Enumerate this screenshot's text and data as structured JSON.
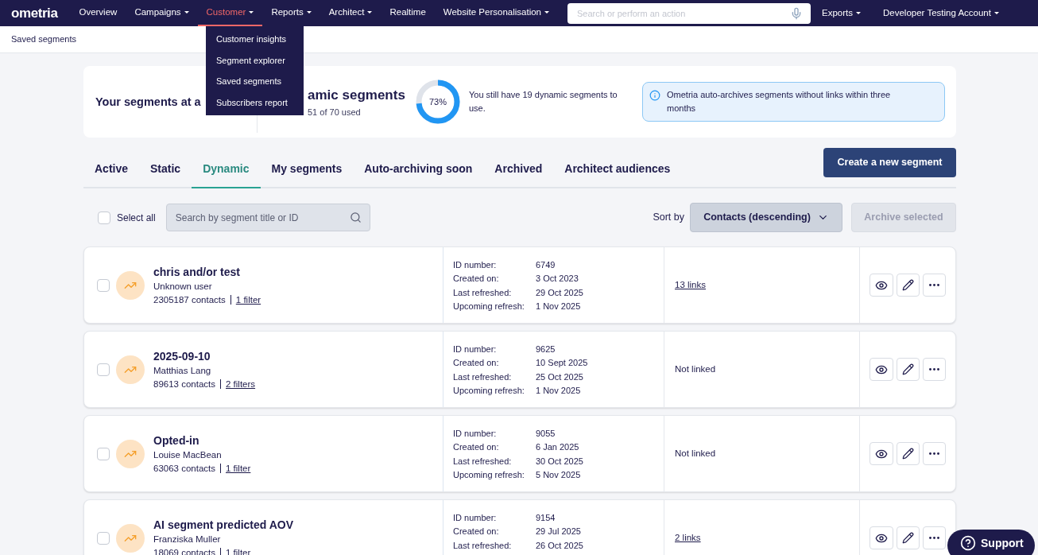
{
  "nav": {
    "logo": "ometria",
    "items": [
      {
        "label": "Overview",
        "menu": false,
        "selected": false
      },
      {
        "label": "Campaigns",
        "menu": true,
        "selected": false
      },
      {
        "label": "Customer",
        "menu": true,
        "selected": true
      },
      {
        "label": "Reports",
        "menu": true,
        "selected": false
      },
      {
        "label": "Architect",
        "menu": true,
        "selected": false
      },
      {
        "label": "Realtime",
        "menu": false,
        "selected": false
      },
      {
        "label": "Website Personalisation",
        "menu": true,
        "selected": false
      }
    ],
    "search": {
      "placeholder": "Search or perform an action"
    },
    "right_items": [
      {
        "label": "Exports",
        "menu": true
      },
      {
        "label": "Developer Testing Account",
        "menu": true
      }
    ]
  },
  "dropdown": {
    "items": [
      "Customer insights",
      "Segment explorer",
      "Saved segments",
      "Subscribers report"
    ]
  },
  "breadcrumb": "Saved segments",
  "summary": {
    "heading": "Your segments at a",
    "title": "amic segments",
    "used": "51 of 70 used",
    "donut": {
      "level": 0.73,
      "label": "73%"
    },
    "remaining": "You still have 19 dynamic segments to use.",
    "info": "Ometria auto-archives segments without links within three months"
  },
  "tabs": [
    {
      "label": "Active",
      "selected": false
    },
    {
      "label": "Static",
      "selected": false
    },
    {
      "label": "Dynamic",
      "selected": true
    },
    {
      "label": "My segments",
      "selected": false
    },
    {
      "label": "Auto-archiving soon",
      "selected": false
    },
    {
      "label": "Archived",
      "selected": false
    },
    {
      "label": "Architect audiences",
      "selected": false
    }
  ],
  "create_button": "Create a new segment",
  "toolbar": {
    "select_all": {
      "label": "Select all",
      "checked": false
    },
    "search": {
      "placeholder": "Search by segment title or ID"
    },
    "sort_label": "Sort by",
    "sort_value": "Contacts (descending)",
    "archive": {
      "label": "Archive selected",
      "disabled": true
    }
  },
  "segments": [
    {
      "checked": false,
      "title": "chris and/or test",
      "owner": "Unknown user",
      "contacts": "2305187 contacts",
      "filters": "1 filter",
      "details": [
        {
          "label": "ID number:",
          "value": "6749"
        },
        {
          "label": "Created on:",
          "value": "3 Oct 2023"
        },
        {
          "label": "Last refreshed:",
          "value": "29 Oct 2025"
        },
        {
          "label": "Upcoming refresh:",
          "value": "1 Nov 2025"
        }
      ],
      "links": {
        "kind": "link",
        "text": "13 links"
      }
    },
    {
      "checked": false,
      "title": "2025-09-10",
      "owner": "Matthias Lang",
      "contacts": "89613 contacts",
      "filters": "2 filters",
      "details": [
        {
          "label": "ID number:",
          "value": "9625"
        },
        {
          "label": "Created on:",
          "value": "10 Sept 2025"
        },
        {
          "label": "Last refreshed:",
          "value": "25 Oct 2025"
        },
        {
          "label": "Upcoming refresh:",
          "value": "1 Nov 2025"
        }
      ],
      "links": {
        "kind": "plain",
        "text": "Not linked"
      }
    },
    {
      "checked": false,
      "title": "Opted-in",
      "owner": "Louise MacBean",
      "contacts": "63063 contacts",
      "filters": "1 filter",
      "details": [
        {
          "label": "ID number:",
          "value": "9055"
        },
        {
          "label": "Created on:",
          "value": "6 Jan 2025"
        },
        {
          "label": "Last refreshed:",
          "value": "30 Oct 2025"
        },
        {
          "label": "Upcoming refresh:",
          "value": "5 Nov 2025"
        }
      ],
      "links": {
        "kind": "plain",
        "text": "Not linked"
      }
    },
    {
      "checked": false,
      "title": "AI segment predicted AOV",
      "owner": "Franziska Muller",
      "contacts": "18069 contacts",
      "filters": "1 filter",
      "details": [
        {
          "label": "ID number:",
          "value": "9154"
        },
        {
          "label": "Created on:",
          "value": "29 Jul 2025"
        },
        {
          "label": "Last refreshed:",
          "value": "26 Oct 2025"
        }
      ],
      "links": {
        "kind": "link",
        "text": "2 links"
      }
    }
  ],
  "support": "Support"
}
